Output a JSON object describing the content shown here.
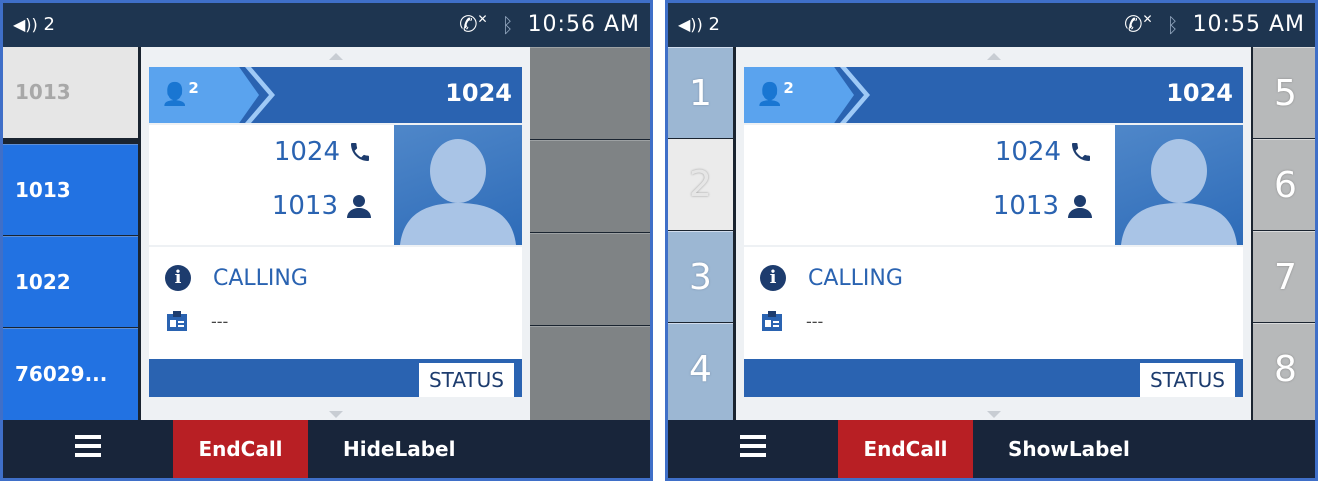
{
  "left": {
    "status": {
      "line_count": "2",
      "time": "10:56 AM"
    },
    "line_keys": [
      "1013",
      "1013",
      "1022",
      "76029..."
    ],
    "call": {
      "number": "1024",
      "conf_count": "2",
      "remote": "1024",
      "local": "1013",
      "state": "CALLING",
      "extra": "---",
      "status_label": "STATUS"
    },
    "softkeys": {
      "end": "EndCall",
      "label": "HideLabel"
    }
  },
  "right": {
    "status": {
      "line_count": "2",
      "time": "10:55 AM"
    },
    "left_keys": [
      "1",
      "2",
      "3",
      "4"
    ],
    "right_keys": [
      "5",
      "6",
      "7",
      "8"
    ],
    "call": {
      "number": "1024",
      "conf_count": "2",
      "remote": "1024",
      "local": "1013",
      "state": "CALLING",
      "extra": "---",
      "status_label": "STATUS"
    },
    "softkeys": {
      "end": "EndCall",
      "label": "ShowLabel"
    }
  },
  "icons": [
    "volume-icon",
    "missed-call-icon",
    "bluetooth-icon",
    "menu-icon",
    "conference-icon",
    "phone-icon",
    "user-icon",
    "info-icon",
    "contact-card-icon",
    "avatar-icon"
  ],
  "colors": {
    "accent": "#2a63b1",
    "line_key_blue": "#2272e2",
    "end_call": "#b81f24",
    "status_bar": "#1e3550"
  }
}
